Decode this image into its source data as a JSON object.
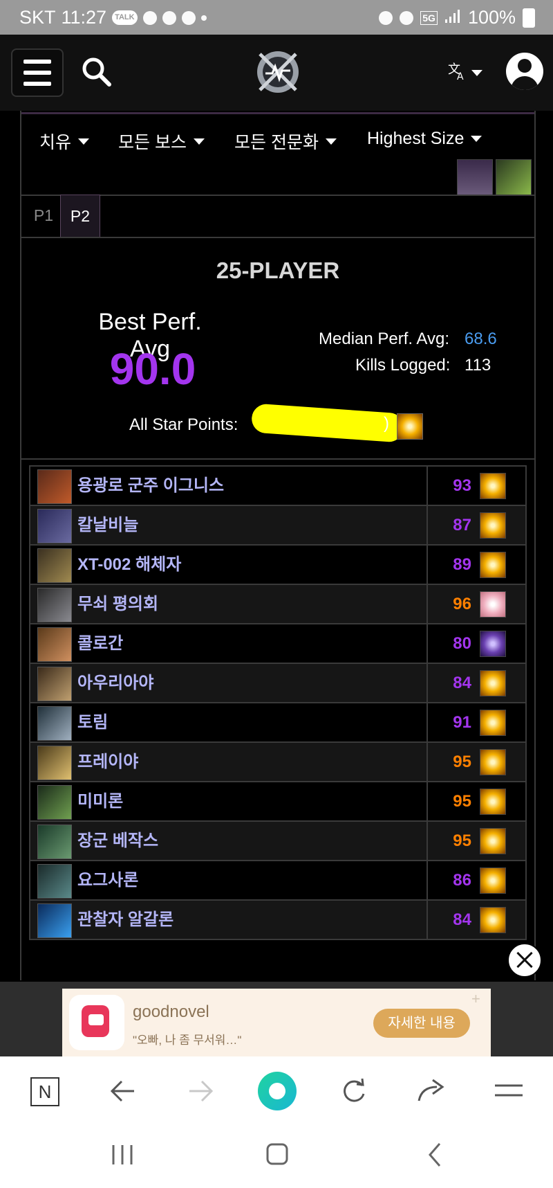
{
  "status_bar": {
    "carrier": "SKT",
    "time": "11:27",
    "talk_badge": "TALK",
    "network": "5G",
    "battery": "100%"
  },
  "filters": [
    {
      "label": "치유"
    },
    {
      "label": "모든 보스"
    },
    {
      "label": "모든 전문화"
    },
    {
      "label": "Highest Size"
    }
  ],
  "tabs": [
    "P1",
    "P2"
  ],
  "summary": {
    "title": "25-PLAYER",
    "best_perf_label": "Best Perf. Avg",
    "best_perf_value": "90.0",
    "median_label": "Median Perf. Avg:",
    "median_value": "68.6",
    "kills_label": "Kills Logged:",
    "kills_value": "113",
    "star_points_label": "All Star Points:",
    "star_points_paren": ")"
  },
  "bosses": [
    {
      "name": "용광로 군주 이그니스",
      "score": "93",
      "score_color": "#a335ee"
    },
    {
      "name": "칼날비늘",
      "score": "87",
      "score_color": "#a335ee"
    },
    {
      "name": "XT-002 해체자",
      "score": "89",
      "score_color": "#a335ee"
    },
    {
      "name": "무쇠 평의회",
      "score": "96",
      "score_color": "#ff8000"
    },
    {
      "name": "콜로간",
      "score": "80",
      "score_color": "#a335ee"
    },
    {
      "name": "아우리아야",
      "score": "84",
      "score_color": "#a335ee"
    },
    {
      "name": "토림",
      "score": "91",
      "score_color": "#a335ee"
    },
    {
      "name": "프레이야",
      "score": "95",
      "score_color": "#ff8000"
    },
    {
      "name": "미미론",
      "score": "95",
      "score_color": "#ff8000"
    },
    {
      "name": "장군 베작스",
      "score": "95",
      "score_color": "#ff8000"
    },
    {
      "name": "요그사론",
      "score": "86",
      "score_color": "#a335ee"
    },
    {
      "name": "관찰자 알갈론",
      "score": "84",
      "score_color": "#a335ee"
    }
  ],
  "ad": {
    "brand": "goodnovel",
    "text": "\"오빠, 나 좀 무서워…\"",
    "cta": "자세한 내용",
    "plus": "+"
  },
  "browser": {
    "tab_icon_label": "N"
  },
  "colors": {
    "legendary_orange": "#ff8000",
    "epic_purple": "#a335ee",
    "median_blue": "#4a9cf0",
    "boss_name": "#b4b6f8",
    "redaction_yellow": "#ffff00"
  }
}
